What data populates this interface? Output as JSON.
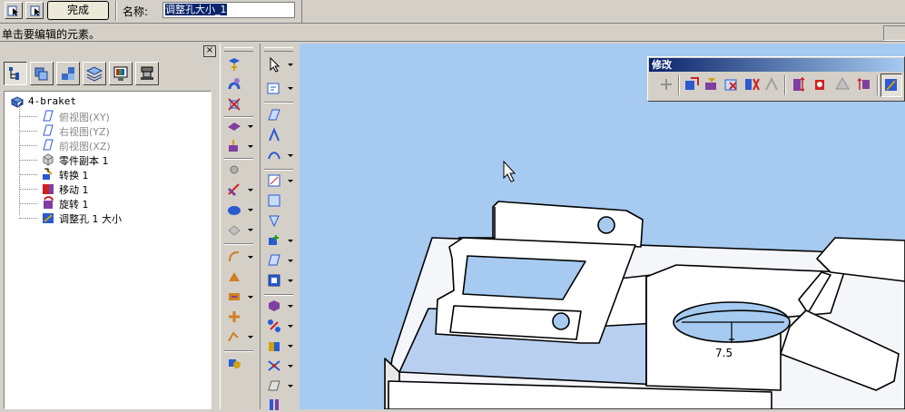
{
  "command_bar": {
    "done_label": "完成",
    "name_label": "名称:",
    "name_value": "调整孔大小_1",
    "icons": [
      "select-previous-icon",
      "select-next-icon"
    ]
  },
  "status": {
    "text": "单击要编辑的元素。"
  },
  "panel": {
    "close_label": "×",
    "tabs": [
      "feature-tree-icon",
      "parts-icon",
      "assembly-icon",
      "layers-icon",
      "display-icon",
      "machine-icon"
    ],
    "tree": {
      "root": "4-braket",
      "items": [
        {
          "label": "俯视图(XY)",
          "icon": "plane-icon",
          "dim": true
        },
        {
          "label": "右视图(YZ)",
          "icon": "plane-icon",
          "dim": true
        },
        {
          "label": "前视图(XZ)",
          "icon": "plane-icon",
          "dim": true
        },
        {
          "label": "零件副本 1",
          "icon": "part-copy-icon",
          "dim": false
        },
        {
          "label": "转换 1",
          "icon": "transform-icon",
          "dim": false
        },
        {
          "label": "移动 1",
          "icon": "move-icon",
          "dim": false
        },
        {
          "label": "旋转 1",
          "icon": "rotate-icon",
          "dim": false
        },
        {
          "label": "调整孔 1 大小",
          "icon": "resize-hole-icon",
          "dim": false
        }
      ]
    }
  },
  "modify_toolbar": {
    "title": "修改",
    "icons": [
      "move-face-icon",
      "offset-icon",
      "extend-icon",
      "delete-face-icon",
      "replace-face-icon",
      "split-icon",
      "resize-hole-icon",
      "resize-round-icon",
      "rotate-face-icon",
      "align-icon",
      "direct-edit-icon"
    ]
  },
  "viewport": {
    "dimension_value": "7.5"
  },
  "colors": {
    "viewport_bg": "#a6caf0",
    "title_bar": "#0a246a",
    "selection": "#0a246a"
  }
}
